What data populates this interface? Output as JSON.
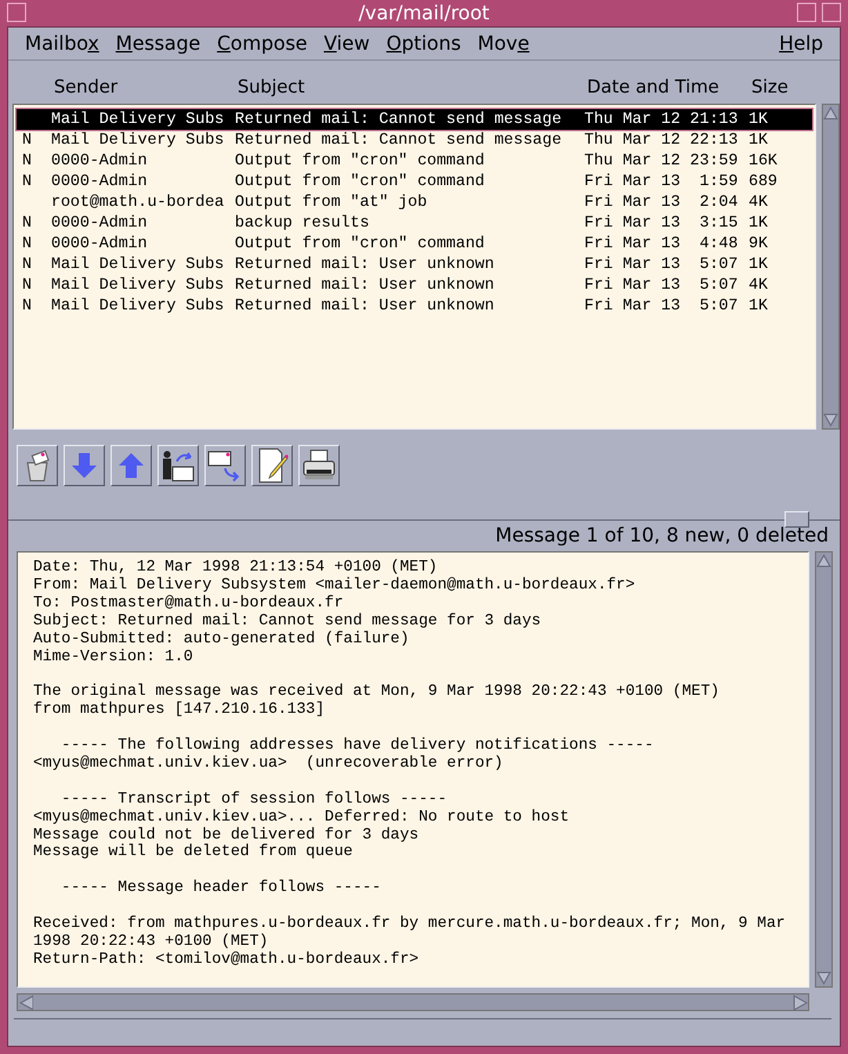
{
  "window": {
    "title": "/var/mail/root"
  },
  "menu": [
    {
      "parts": [
        {
          "text": "Mailbo",
          "underlined": false
        },
        {
          "text": "x",
          "underlined": true
        }
      ]
    },
    {
      "parts": [
        {
          "text": "M",
          "underlined": true
        },
        {
          "text": "essage",
          "underlined": false
        }
      ]
    },
    {
      "parts": [
        {
          "text": "C",
          "underlined": true
        },
        {
          "text": "ompose",
          "underlined": false
        }
      ]
    },
    {
      "parts": [
        {
          "text": "V",
          "underlined": true
        },
        {
          "text": "iew",
          "underlined": false
        }
      ]
    },
    {
      "parts": [
        {
          "text": "O",
          "underlined": true
        },
        {
          "text": "ptions",
          "underlined": false
        }
      ]
    },
    {
      "parts": [
        {
          "text": "Mov",
          "underlined": false
        },
        {
          "text": "e",
          "underlined": true
        }
      ]
    },
    {
      "parts": [
        {
          "text": "H",
          "underlined": true
        },
        {
          "text": "elp",
          "underlined": false
        }
      ]
    }
  ],
  "columns": [
    "Sender",
    "Subject",
    "Date and Time",
    "Size"
  ],
  "messages": [
    {
      "sender": "Mail Delivery Subs",
      "subject": "Returned mail: Cannot send message",
      "date": "Thu Mar 12 21:13",
      "size": "1K",
      "selected": true
    },
    {
      "flag": "N",
      "sender": "Mail Delivery Subs",
      "subject": "Returned mail: Cannot send message",
      "date": "Thu Mar 12 22:13",
      "size": "1K",
      "selected": false
    },
    {
      "flag": "N",
      "sender": "0000-Admin",
      "subject": "Output from \"cron\" command",
      "date": "Thu Mar 12 23:59",
      "size": "16K",
      "selected": false
    },
    {
      "flag": "N",
      "sender": "0000-Admin",
      "subject": "Output from \"cron\" command",
      "date": "Fri Mar 13  1:59",
      "size": "689",
      "selected": false
    },
    {
      "sender": "root@math.u-bordea",
      "subject": "Output from \"at\" job",
      "date": "Fri Mar 13  2:04",
      "size": "4K",
      "selected": false
    },
    {
      "flag": "N",
      "sender": "0000-Admin",
      "subject": "backup results",
      "date": "Fri Mar 13  3:15",
      "size": "1K",
      "selected": false
    },
    {
      "flag": "N",
      "sender": "0000-Admin",
      "subject": "Output from \"cron\" command",
      "date": "Fri Mar 13  4:48",
      "size": "9K",
      "selected": false
    },
    {
      "flag": "N",
      "sender": "Mail Delivery Subs",
      "subject": "Returned mail: User unknown",
      "date": "Fri Mar 13  5:07",
      "size": "1K",
      "selected": false
    },
    {
      "flag": "N",
      "sender": "Mail Delivery Subs",
      "subject": "Returned mail: User unknown",
      "date": "Fri Mar 13  5:07",
      "size": "4K",
      "selected": false
    },
    {
      "flag": "N",
      "sender": "Mail Delivery Subs",
      "subject": "Returned mail: User unknown",
      "date": "Fri Mar 13  5:07",
      "size": "1K",
      "selected": false
    }
  ],
  "toolbar": [
    {
      "kind": "delete"
    },
    {
      "kind": "next"
    },
    {
      "kind": "previous"
    },
    {
      "kind": "reply"
    },
    {
      "kind": "forward"
    },
    {
      "kind": "compose"
    },
    {
      "kind": "print"
    }
  ],
  "status": "Message 1 of 10, 8 new, 0 deleted",
  "body": [
    "Date: Thu, 12 Mar 1998 21:13:54 +0100 (MET)\nFrom: Mail Delivery Subsystem <mailer-daemon@math.u-bordeaux.fr>\nTo: Postmaster@math.u-bordeaux.fr\nSubject: Returned mail: Cannot send message for 3 days\nAuto-Submitted: auto-generated (failure)\nMime-Version: 1.0",
    "The original message was received at Mon, 9 Mar 1998 20:22:43 +0100 (MET)\nfrom mathpures [147.210.16.133]",
    "   ----- The following addresses have delivery notifications -----\n<myus@mechmat.univ.kiev.ua>  (unrecoverable error)",
    "   ----- Transcript of session follows -----\n<myus@mechmat.univ.kiev.ua>... Deferred: No route to host\nMessage could not be delivered for 3 days\nMessage will be deleted from queue",
    "   ----- Message header follows -----",
    "Received: from mathpures.u-bordeaux.fr by mercure.math.u-bordeaux.fr; Mon, 9 Mar\n1998 20:22:43 +0100 (MET)\nReturn-Path: <tomilov@math.u-bordeaux.fr>"
  ]
}
